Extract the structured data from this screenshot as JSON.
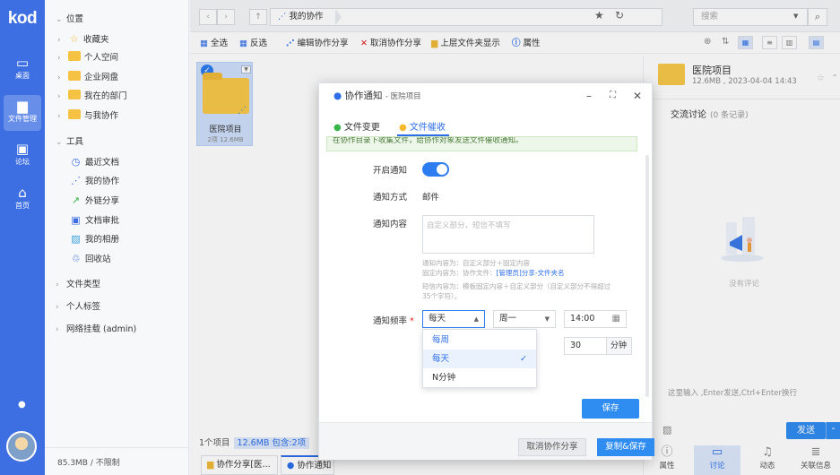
{
  "app": {
    "logo": "kod"
  },
  "rail": {
    "items": [
      {
        "label": "桌面",
        "icon": "desktop-icon",
        "glyph": "▭"
      },
      {
        "label": "文件管理",
        "icon": "folder-icon",
        "glyph": "▆"
      },
      {
        "label": "论坛",
        "icon": "chat-icon",
        "glyph": "▣"
      },
      {
        "label": "首页",
        "icon": "home-icon",
        "glyph": "⌂"
      }
    ],
    "bell_glyph": "●"
  },
  "tree": {
    "position": {
      "label": "位置",
      "items": [
        "收藏夹",
        "个人空间",
        "企业网盘",
        "我在的部门",
        "与我协作"
      ]
    },
    "tools": {
      "label": "工具",
      "items": [
        "最近文档",
        "我的协作",
        "外链分享",
        "文档审批",
        "我的相册",
        "回收站"
      ]
    },
    "others": [
      "文件类型",
      "个人标签",
      "网络挂载 (admin)"
    ],
    "quota": "85.3MB / 不限制"
  },
  "address": {
    "crumb": "我的协作",
    "search_placeholder": "搜索"
  },
  "toolbar": {
    "select_all": "全选",
    "invert": "反选",
    "edit_share": "编辑协作分享",
    "cancel_share": "取消协作分享",
    "up_folder": "上层文件夹显示",
    "props": "属性"
  },
  "file": {
    "name": "医院项目",
    "meta": "2项 12.6MB"
  },
  "status": {
    "count": "1个项目",
    "selected": "12.6MB 包含:2项"
  },
  "bottom_tabs": [
    "协作分享[医...",
    "协作通知"
  ],
  "right_panel": {
    "title": "医院项目",
    "meta": "12.6MB , 2023-04-04 14:43",
    "discussion": "交流讨论",
    "discussion_count": "(0 条记录)",
    "empty": "没有评论",
    "hint": "这里输入 ,Enter发送,Ctrl+Enter换行",
    "send": "发送",
    "tabs": [
      "属性",
      "讨论",
      "动态",
      "关联信息"
    ]
  },
  "dialog": {
    "title": "协作通知",
    "subtitle": "- 医院项目",
    "tabs": [
      "文件变更",
      "文件催收"
    ],
    "notice": "在协作目录下收集文件，给协作对象发送文件催收通知。",
    "enable_label": "开启通知",
    "method_label": "通知方式",
    "method_value": "邮件",
    "content_label": "通知内容",
    "content_placeholder": "自定义部分，短信不填写",
    "help1": "通知内容为：自定义部分＋固定内容",
    "help2a": "固定内容为：协作文件：",
    "help2b": "[管理员]分享-文件夹名",
    "help3": "短信内容为：模板固定内容＋自定义部分（自定义部分不得超过",
    "help4": "35个字符）。",
    "freq_label": "通知频率",
    "freq_value": "每天",
    "week_value": "周一",
    "time_value": "14:00",
    "minutes_value": "30",
    "minutes_unit": "分钟",
    "options": [
      "每周",
      "每天",
      "N分钟"
    ],
    "save": "保存",
    "cancel_share": "取消协作分享",
    "copy_save": "复制&保存"
  }
}
